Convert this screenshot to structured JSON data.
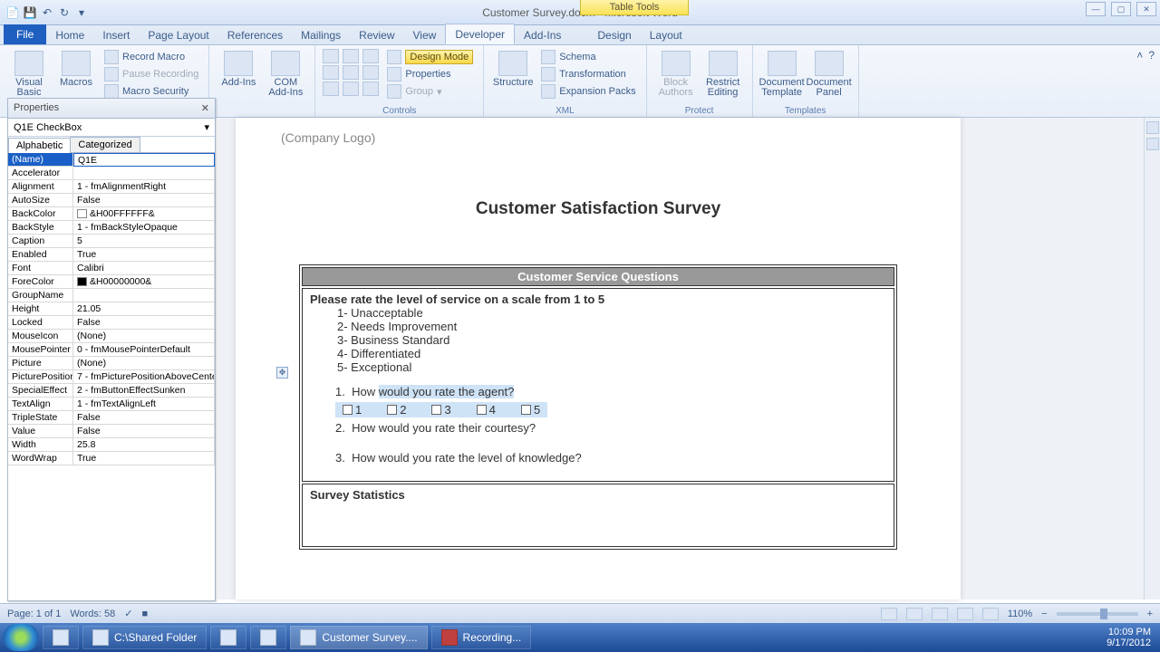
{
  "title": "Customer Survey.docm - Microsoft Word",
  "table_tools": "Table Tools",
  "tabs": [
    "File",
    "Home",
    "Insert",
    "Page Layout",
    "References",
    "Mailings",
    "Review",
    "View",
    "Developer",
    "Add-Ins",
    "Design",
    "Layout"
  ],
  "active_tab": "Developer",
  "ribbon": {
    "code": {
      "visual": "Visual Basic",
      "macros": "Macros",
      "record": "Record Macro",
      "pause": "Pause Recording",
      "security": "Macro Security",
      "label": ""
    },
    "addins": {
      "addins": "Add-Ins",
      "com": "COM Add-Ins",
      "label": ""
    },
    "controls": {
      "design": "Design Mode",
      "properties": "Properties",
      "group": "Group",
      "label": "Controls"
    },
    "xml": {
      "structure": "Structure",
      "schema": "Schema",
      "transformation": "Transformation",
      "expansion": "Expansion Packs",
      "label": "XML"
    },
    "protect": {
      "block": "Block Authors",
      "restrict": "Restrict Editing",
      "label": "Protect"
    },
    "templates": {
      "doc_template": "Document Template",
      "doc_panel": "Document Panel",
      "label": "Templates"
    }
  },
  "props": {
    "title": "Properties",
    "selector": "Q1E  CheckBox",
    "tab_alpha": "Alphabetic",
    "tab_cat": "Categorized",
    "rows": [
      {
        "k": "(Name)",
        "v": "Q1E",
        "sel": true
      },
      {
        "k": "Accelerator",
        "v": ""
      },
      {
        "k": "Alignment",
        "v": "1 - fmAlignmentRight"
      },
      {
        "k": "AutoSize",
        "v": "False"
      },
      {
        "k": "BackColor",
        "v": "&H00FFFFFF&",
        "swatch": "#ffffff"
      },
      {
        "k": "BackStyle",
        "v": "1 - fmBackStyleOpaque"
      },
      {
        "k": "Caption",
        "v": "5"
      },
      {
        "k": "Enabled",
        "v": "True"
      },
      {
        "k": "Font",
        "v": "Calibri"
      },
      {
        "k": "ForeColor",
        "v": "&H00000000&",
        "swatch": "#000000"
      },
      {
        "k": "GroupName",
        "v": ""
      },
      {
        "k": "Height",
        "v": "21.05"
      },
      {
        "k": "Locked",
        "v": "False"
      },
      {
        "k": "MouseIcon",
        "v": "(None)"
      },
      {
        "k": "MousePointer",
        "v": "0 - fmMousePointerDefault"
      },
      {
        "k": "Picture",
        "v": "(None)"
      },
      {
        "k": "PicturePosition",
        "v": "7 - fmPicturePositionAboveCenter"
      },
      {
        "k": "SpecialEffect",
        "v": "2 - fmButtonEffectSunken"
      },
      {
        "k": "TextAlign",
        "v": "1 - fmTextAlignLeft"
      },
      {
        "k": "TripleState",
        "v": "False"
      },
      {
        "k": "Value",
        "v": "False"
      },
      {
        "k": "Width",
        "v": "25.8"
      },
      {
        "k": "WordWrap",
        "v": "True"
      }
    ]
  },
  "doc": {
    "company": "(Company Logo)",
    "title": "Customer Satisfaction Survey",
    "section": "Customer Service Questions",
    "rate_head": "Please rate the level of service on a scale from 1 to 5",
    "scale": [
      "1-     Unacceptable",
      "2-     Needs Improvement",
      "3-     Business Standard",
      "4-     Differentiated",
      "5-     Exceptional"
    ],
    "q1_num": "1.",
    "q1": "How would you rate the agent?",
    "q2_num": "2.",
    "q2": "How would you rate their courtesy?",
    "q3_num": "3.",
    "q3": "How would you rate the level of knowledge?",
    "checks": [
      "1",
      "2",
      "3",
      "4",
      "5"
    ],
    "stats": "Survey Statistics"
  },
  "status": {
    "page": "Page: 1 of 1",
    "words": "Words: 58",
    "zoom": "110%"
  },
  "taskbar": {
    "shared": "C:\\Shared Folder",
    "word": "Customer Survey....",
    "rec": "Recording...",
    "time": "10:09 PM",
    "date": "9/17/2012"
  }
}
